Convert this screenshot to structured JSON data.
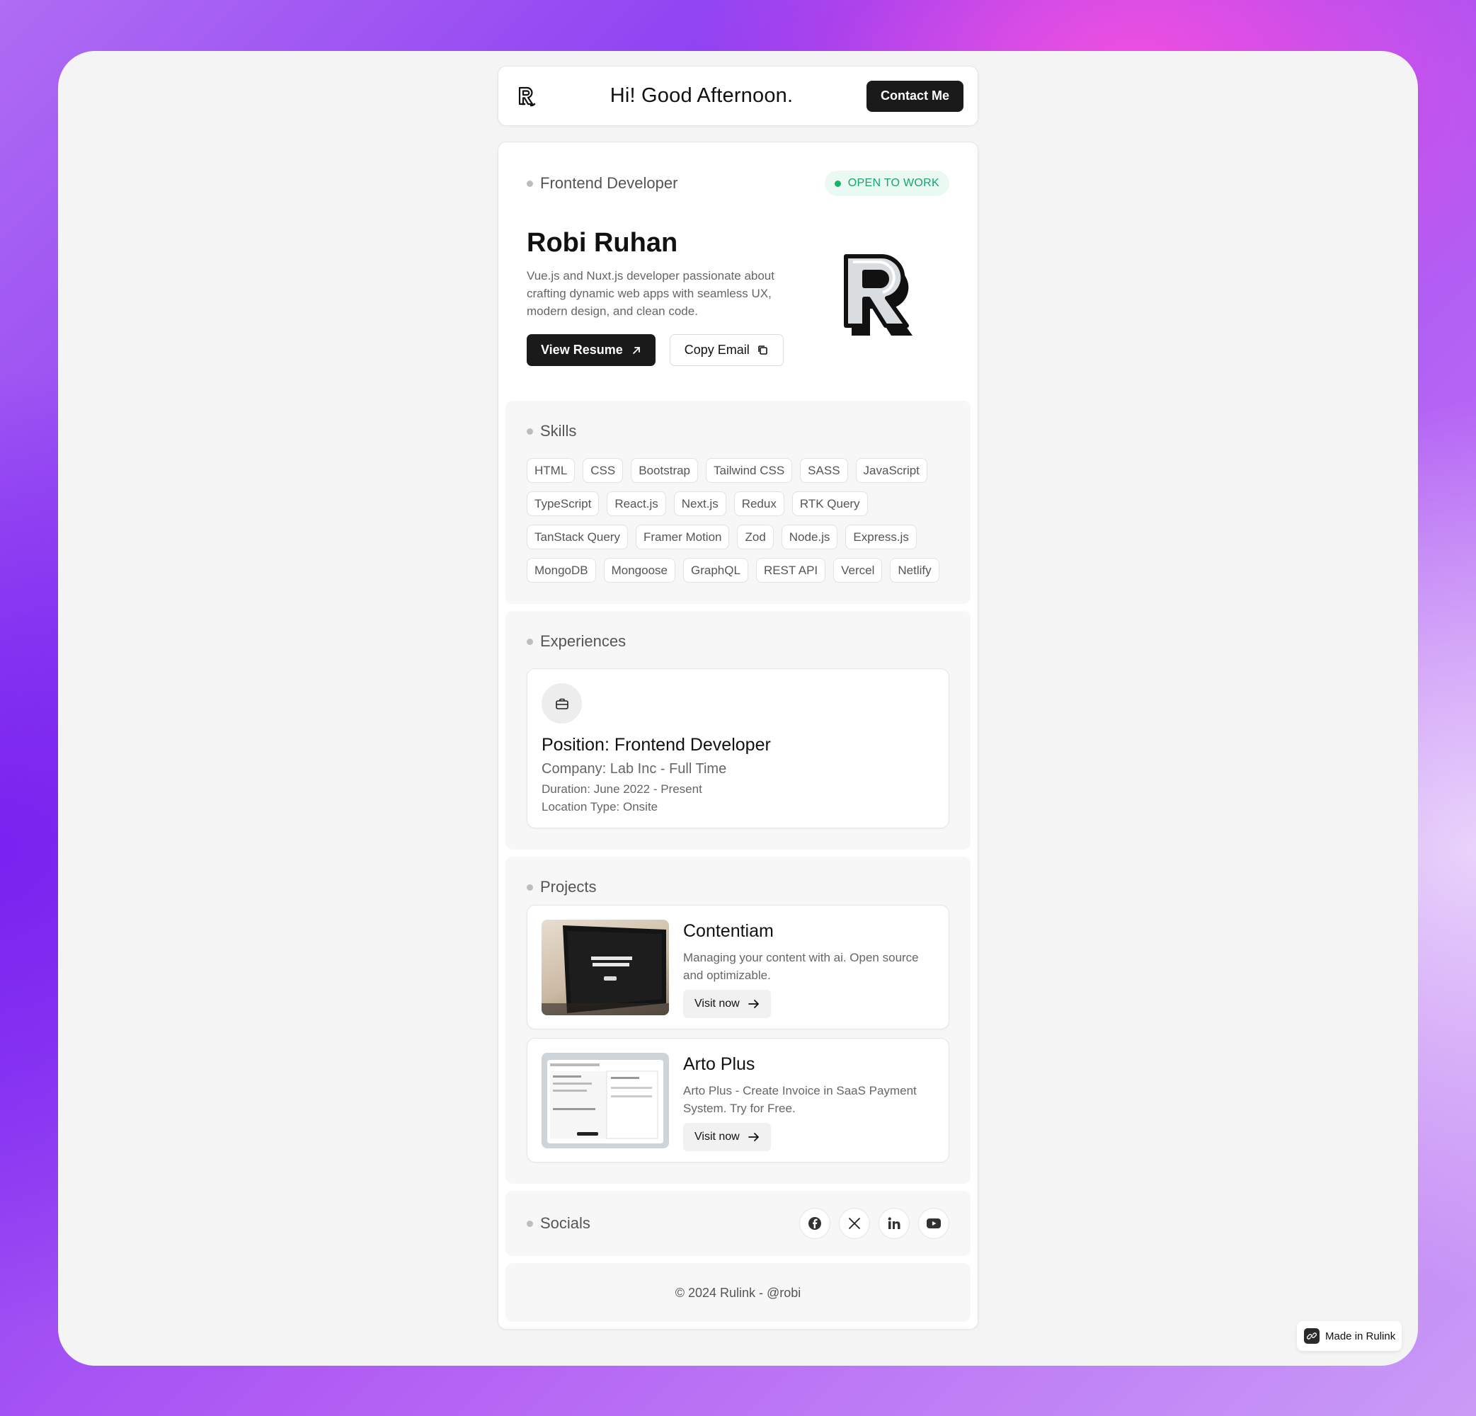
{
  "header": {
    "greeting": "Hi! Good Afternoon.",
    "contact_label": "Contact Me"
  },
  "hero": {
    "role": "Frontend Developer",
    "status": "OPEN TO WORK",
    "name": "Robi Ruhan",
    "bio": "Vue.js and Nuxt.js developer passionate about crafting dynamic web apps with seamless UX, modern design, and clean code.",
    "resume_label": "View Resume",
    "copy_email_label": "Copy Email"
  },
  "skills": {
    "title": "Skills",
    "items": [
      "HTML",
      "CSS",
      "Bootstrap",
      "Tailwind CSS",
      "SASS",
      "JavaScript",
      "TypeScript",
      "React.js",
      "Next.js",
      "Redux",
      "RTK Query",
      "TanStack Query",
      "Framer Motion",
      "Zod",
      "Node.js",
      "Express.js",
      "MongoDB",
      "Mongoose",
      "GraphQL",
      "REST API",
      "Vercel",
      "Netlify"
    ]
  },
  "experiences": {
    "title": "Experiences",
    "items": [
      {
        "position": "Position: Frontend Developer",
        "company": "Company: Lab Inc - Full Time",
        "duration": "Duration: June 2022 - Present",
        "location": "Location Type: Onsite"
      }
    ]
  },
  "projects": {
    "title": "Projects",
    "items": [
      {
        "title": "Contentiam",
        "desc": "Managing your content with ai. Open source and optimizable.",
        "link_label": "Visit now"
      },
      {
        "title": "Arto Plus",
        "desc": "Arto Plus - Create Invoice in SaaS Payment System. Try for Free.",
        "link_label": "Visit now"
      }
    ]
  },
  "socials": {
    "title": "Socials",
    "icons": [
      "facebook-icon",
      "x-icon",
      "linkedin-icon",
      "youtube-icon"
    ]
  },
  "footer": {
    "text": "© 2024 Rulink - @robi"
  },
  "badge": {
    "label": "Made in Rulink"
  },
  "colors": {
    "accent_dark": "#1a1a1a",
    "status_green": "#17b26a",
    "background": "#f4f4f4"
  }
}
